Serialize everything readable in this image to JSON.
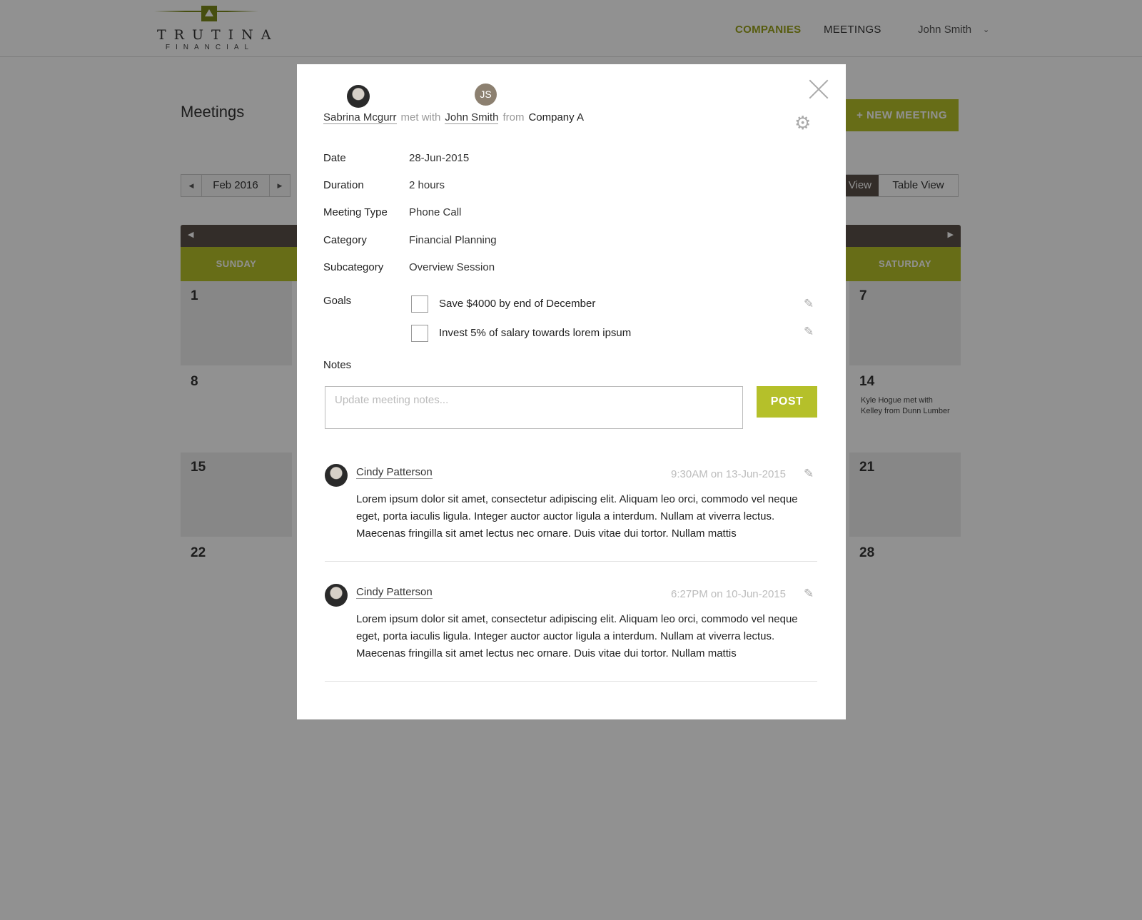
{
  "nav": {
    "logo_word": "TRUTINA",
    "logo_sub": "FINANCIAL",
    "companies": "COMPANIES",
    "meetings": "MEETINGS",
    "user": "John Smith"
  },
  "page": {
    "title": "Meetings",
    "new_meeting": "+ NEW MEETING",
    "month": "Feb 2016",
    "calendar_view": "View",
    "table_view": "Table View"
  },
  "calendar": {
    "days": [
      "SUNDAY",
      "SATURDAY"
    ],
    "cells": [
      {
        "num": "1",
        "event": ""
      },
      {
        "num": "7",
        "event": ""
      },
      {
        "num": "8",
        "event": ""
      },
      {
        "num": "14",
        "event": "Kyle Hogue met with Kelley from Dunn Lumber"
      },
      {
        "num": "15",
        "event": ""
      },
      {
        "num": "21",
        "event": ""
      },
      {
        "num": "22",
        "event": ""
      },
      {
        "num": "28",
        "event": ""
      }
    ]
  },
  "modal": {
    "host": "Sabrina Mcgurr",
    "met_with": "met with",
    "guest": "John Smith",
    "guest_initials": "JS",
    "from": "from",
    "company": "Company A",
    "fields": [
      {
        "label": "Date",
        "value": "28-Jun-2015"
      },
      {
        "label": "Duration",
        "value": "2 hours"
      },
      {
        "label": "Meeting Type",
        "value": "Phone Call"
      },
      {
        "label": "Category",
        "value": "Financial Planning"
      },
      {
        "label": "Subcategory",
        "value": "Overview Session"
      }
    ],
    "goals_label": "Goals",
    "goals": [
      {
        "text": "Save $4000 by end of December",
        "checked": false
      },
      {
        "text": "Invest 5% of salary towards lorem ipsum",
        "checked": false
      }
    ],
    "notes_label": "Notes",
    "notes_placeholder": "Update meeting notes...",
    "post": "POST",
    "comments": [
      {
        "author": "Cindy Patterson",
        "time": "9:30AM on 13-Jun-2015",
        "body": "Lorem ipsum dolor sit amet, consectetur adipiscing elit. Aliquam leo orci, commodo vel neque eget, porta iaculis ligula. Integer auctor auctor ligula a interdum. Nullam at viverra lectus. Maecenas fringilla sit amet lectus nec ornare. Duis vitae dui tortor. Nullam mattis"
      },
      {
        "author": "Cindy Patterson",
        "time": "6:27PM on 10-Jun-2015",
        "body": "Lorem ipsum dolor sit amet, consectetur adipiscing elit. Aliquam leo orci, commodo vel neque eget, porta iaculis ligula. Integer auctor auctor ligula a interdum. Nullam at viverra lectus. Maecenas fringilla sit amet lectus nec ornare. Duis vitae dui tortor. Nullam mattis"
      }
    ]
  },
  "icons": {
    "close": "close-icon",
    "gear": "gear-icon",
    "pencil": "pencil-icon",
    "caret": "chevron-down-icon"
  },
  "colors": {
    "accent": "#b5c02a",
    "nav_active": "#9aa21b",
    "calendar_header": "#5b5048"
  }
}
